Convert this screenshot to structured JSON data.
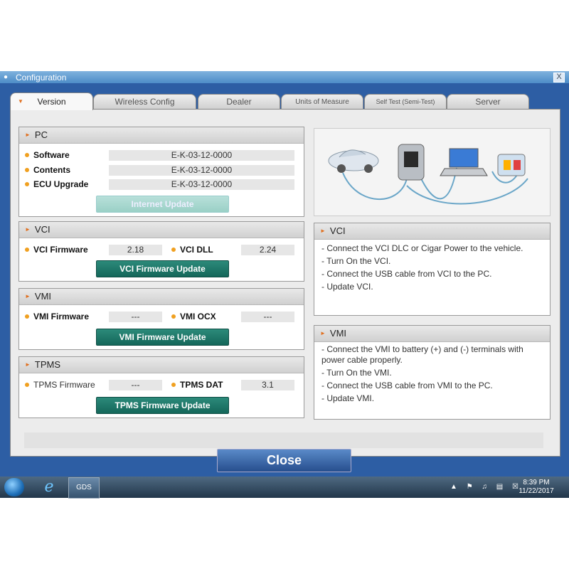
{
  "window": {
    "title": "Configuration",
    "close_glyph": "X"
  },
  "tabs": [
    {
      "label": "Version"
    },
    {
      "label": "Wireless Config"
    },
    {
      "label": "Dealer"
    },
    {
      "label": "Units of Measure"
    },
    {
      "label": "Self Test (Semi-Test)"
    },
    {
      "label": "Server"
    }
  ],
  "pc": {
    "header": "PC",
    "software_label": "Software",
    "software_value": "E-K-03-12-0000",
    "contents_label": "Contents",
    "contents_value": "E-K-03-12-0000",
    "ecu_label": "ECU Upgrade",
    "ecu_value": "E-K-03-12-0000",
    "update_button": "Internet Update"
  },
  "vci": {
    "header": "VCI",
    "firmware_label": "VCI Firmware",
    "firmware_value": "2.18",
    "dll_label": "VCI DLL",
    "dll_value": "2.24",
    "update_button": "VCI Firmware Update"
  },
  "vmi": {
    "header": "VMI",
    "firmware_label": "VMI Firmware",
    "firmware_value": "---",
    "ocx_label": "VMI OCX",
    "ocx_value": "---",
    "update_button": "VMI Firmware Update"
  },
  "tpms": {
    "header": "TPMS",
    "firmware_label": "TPMS Firmware",
    "firmware_value": "---",
    "dat_label": "TPMS DAT",
    "dat_value": "3.1",
    "update_button": "TPMS Firmware Update"
  },
  "vci_info": {
    "header": "VCI",
    "lines": [
      "- Connect the VCI DLC or Cigar Power to the vehicle.",
      "- Turn On the VCI.",
      "- Connect the USB cable from VCI to the PC.",
      "- Update VCI."
    ]
  },
  "vmi_info": {
    "header": "VMI",
    "lines": [
      "- Connect the VMI to battery (+) and (-) terminals with power cable properly.",
      "- Turn On the VMI.",
      "- Connect the USB cable from VMI to the PC.",
      "- Update VMI."
    ]
  },
  "close_button": "Close",
  "taskbar": {
    "gds_label": "GDS",
    "time": "8:39 PM",
    "date": "11/22/2017"
  },
  "icons": {
    "tab_arrow": "orange-arrow-icon",
    "header_arrow": "orange-arrow-icon",
    "start": "windows-start-icon",
    "browser": "internet-explorer-icon"
  },
  "colors": {
    "window_blue": "#2d5ea4",
    "update_button": "#14675a",
    "accent_orange": "#e07020"
  }
}
